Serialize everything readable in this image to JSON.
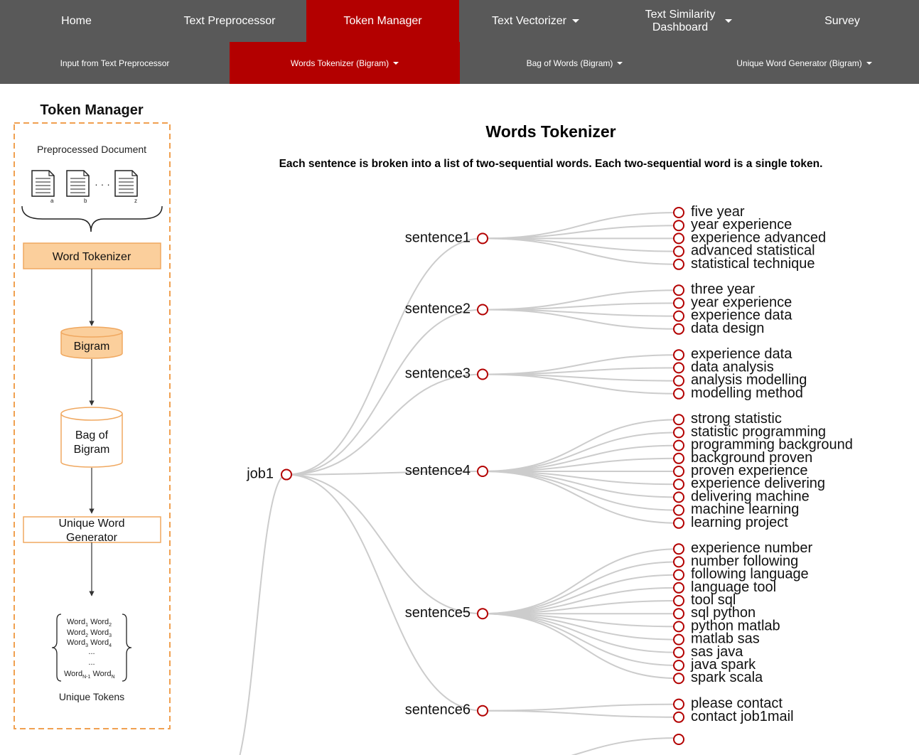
{
  "nav_primary": [
    {
      "label": "Home"
    },
    {
      "label": "Text Preprocessor"
    },
    {
      "label": "Token Manager",
      "active": true
    },
    {
      "label": "Text Vectorizer",
      "dropdown": true
    },
    {
      "label_line1": "Text Similarity",
      "label_line2": "Dashboard",
      "dropdown": true
    },
    {
      "label": "Survey"
    }
  ],
  "nav_secondary": [
    {
      "label": "Input from Text Preprocessor"
    },
    {
      "label": "Words Tokenizer (Bigram)",
      "dropdown": true,
      "active": true
    },
    {
      "label": "Bag of Words (Bigram)",
      "dropdown": true
    },
    {
      "label": "Unique Word Generator (Bigram)",
      "dropdown": true
    }
  ],
  "sidebar": {
    "title": "Token Manager",
    "preprocessed_label": "Preprocessed Document",
    "doc_subscripts": [
      "a",
      "b",
      "z"
    ],
    "doc_dots": "· · ·",
    "word_tokenizer": "Word Tokenizer",
    "bigram": "Bigram",
    "bag_line1": "Bag of",
    "bag_line2": "Bigram",
    "unique_line1": "Unique Word",
    "unique_line2": "Generator",
    "word_word": "Word",
    "token_rows": [
      [
        "1",
        "2"
      ],
      [
        "2",
        "3"
      ],
      [
        "3",
        "4"
      ]
    ],
    "token_last": [
      "N-1",
      "N"
    ],
    "ellipsis": "...",
    "unique_tokens": "Unique Tokens"
  },
  "main": {
    "title": "Words Tokenizer",
    "subtitle": "Each sentence is broken into a list of two-sequential words. Each two-sequential word is a single token."
  },
  "colors": {
    "nav_bg": "#595959",
    "active": "#b30000",
    "link": "#cccccc",
    "node_stroke": "#b30000",
    "box_fill": "#fbcf9c",
    "box_stroke": "#f0a860"
  },
  "tree": {
    "name": "job1",
    "children": [
      {
        "name": "sentence1",
        "children": [
          "five year",
          "year experience",
          "experience advanced",
          "advanced statistical",
          "statistical technique"
        ]
      },
      {
        "name": "sentence2",
        "children": [
          "three year",
          "year experience",
          "experience data",
          "data design"
        ]
      },
      {
        "name": "sentence3",
        "children": [
          "experience data",
          "data analysis",
          "analysis modelling",
          "modelling method"
        ]
      },
      {
        "name": "sentence4",
        "children": [
          "strong statistic",
          "statistic programming",
          "programming background",
          "background proven",
          "proven experience",
          "experience delivering",
          "delivering machine",
          "machine learning",
          "learning project"
        ]
      },
      {
        "name": "sentence5",
        "children": [
          "experience number",
          "number following",
          "following language",
          "language tool",
          "tool sql",
          "sql python",
          "python matlab",
          "matlab sas",
          "sas java",
          "java spark",
          "spark scala"
        ]
      },
      {
        "name": "sentence6",
        "children": [
          "please contact",
          "contact job1mail"
        ]
      }
    ]
  }
}
